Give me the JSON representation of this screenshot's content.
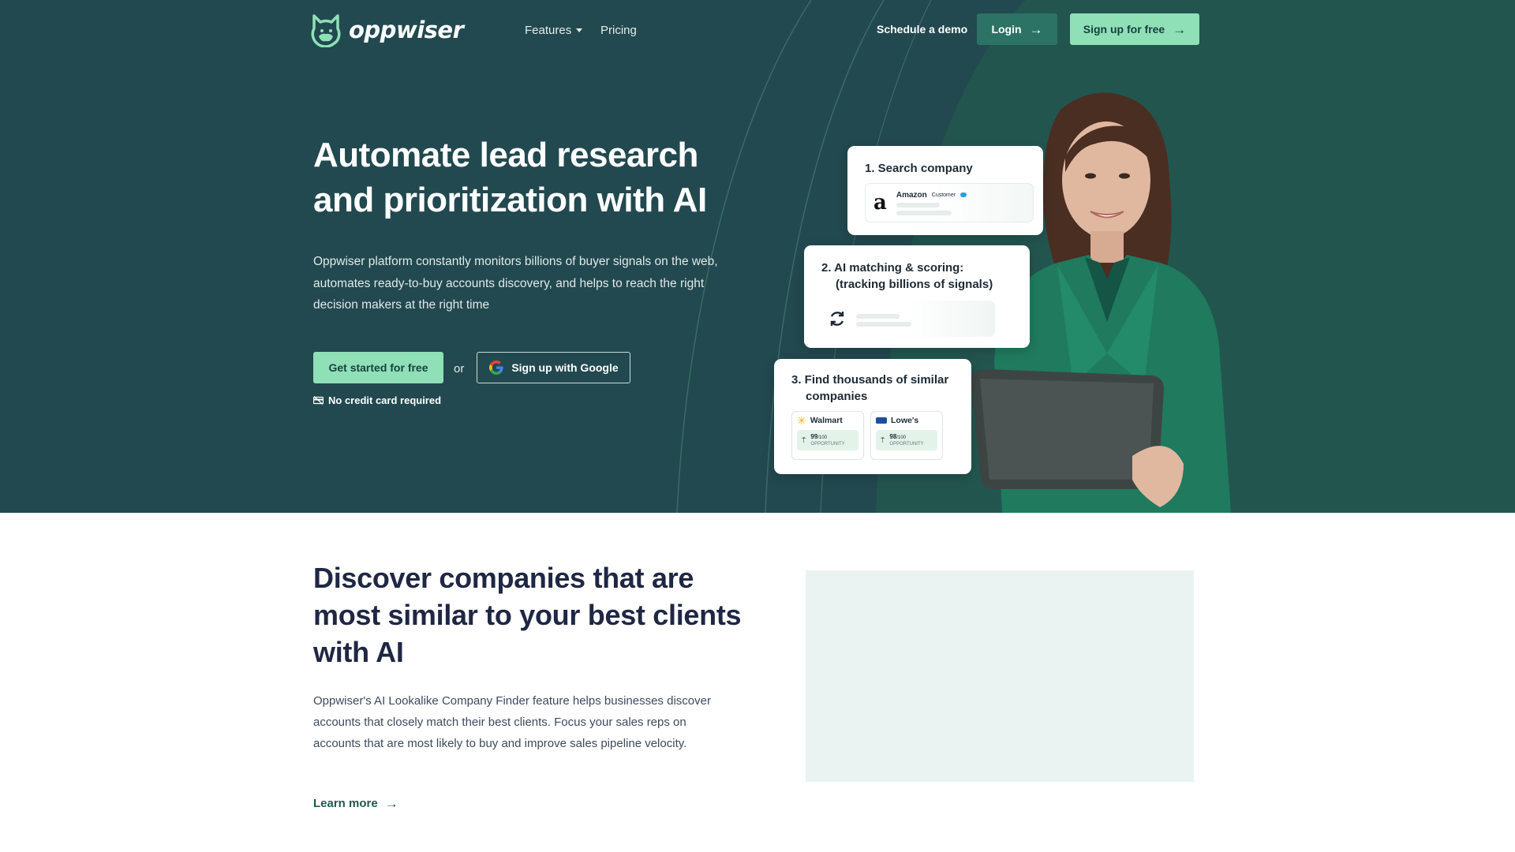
{
  "nav": {
    "logo_text": "oppwiser",
    "features_label": "Features",
    "pricing_label": "Pricing",
    "demo_label": "Schedule a demo",
    "login_label": "Login",
    "signup_label": "Sign up for free"
  },
  "hero": {
    "title": "Automate lead research and prioritization with AI",
    "description": "Oppwiser platform constantly monitors billions of buyer signals on the web, automates ready-to-buy accounts discovery, and helps to reach the right decision makers at the right time",
    "cta_primary": "Get started for free",
    "or_text": "or",
    "cta_google": "Sign up with Google",
    "no_card_note": "No credit card required"
  },
  "cards": {
    "step1_title": "1. Search company",
    "step1_company": "Amazon",
    "step1_badge": "Customer",
    "step2_title_line1": "2. AI matching & scoring:",
    "step2_title_line2": "(tracking billions of signals)",
    "step3_title_line1": "3. Find thousands of similar",
    "step3_title_line2": "companies",
    "companies": [
      {
        "name": "Walmart",
        "score": "99",
        "score_max": "/100",
        "score_label": "OPPORTUNITY"
      },
      {
        "name": "Lowe's",
        "score": "98",
        "score_max": "/100",
        "score_label": "OPPORTUNITY"
      }
    ]
  },
  "section2": {
    "title": "Discover companies that are most similar to your best clients with AI",
    "description": "Oppwiser's AI Lookalike Company Finder feature helps businesses discover accounts that closely match their best clients. Focus your sales reps on accounts that are most likely to buy and improve sales pipeline velocity.",
    "learn_more": "Learn more"
  },
  "colors": {
    "hero_bg": "#22494f",
    "accent_mint": "#8fe0b6",
    "login_bg": "#2c7365",
    "jacket_green": "#1f7a5e",
    "media_box": "#eaf3f1"
  },
  "icons": [
    "logo-cat-icon",
    "chevron-down-icon",
    "arrow-right-icon",
    "google-icon",
    "no-credit-card-icon",
    "refresh-icon",
    "walmart-spark-icon",
    "lowes-logo-icon",
    "signal-icon"
  ]
}
